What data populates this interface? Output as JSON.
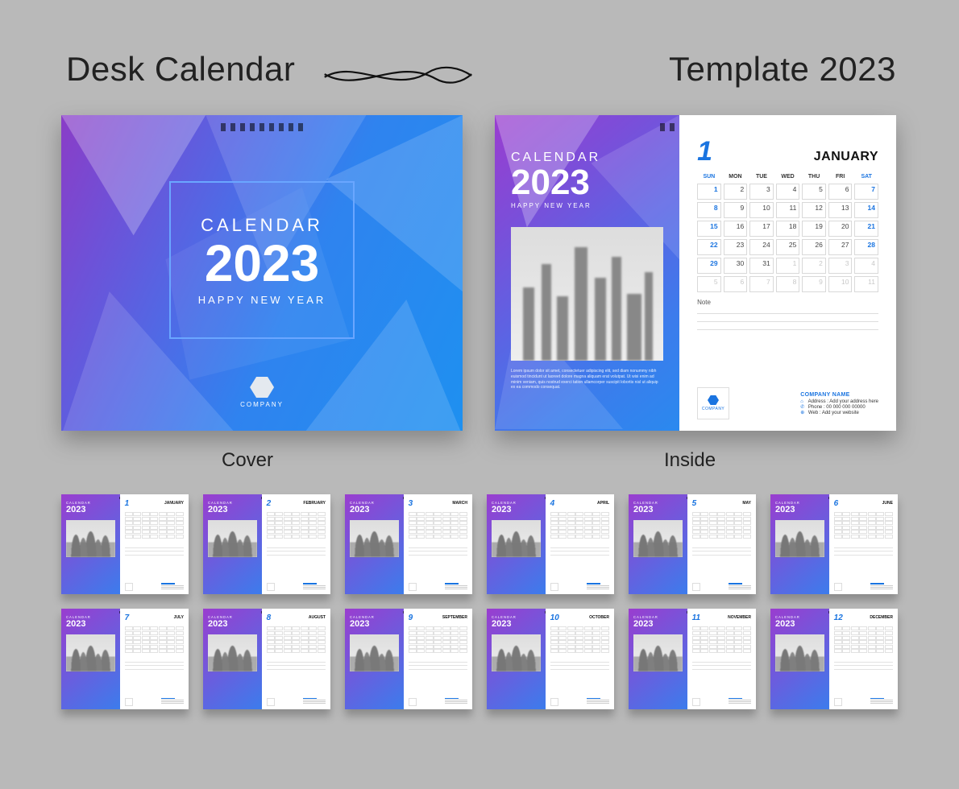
{
  "header": {
    "left": "Desk Calendar",
    "right": "Template 2023"
  },
  "labels": {
    "cover": "Cover",
    "inside": "Inside"
  },
  "cover": {
    "word": "CALENDAR",
    "year": "2023",
    "happy": "HAPPY NEW YEAR",
    "logo_text": "COMPANY"
  },
  "inside": {
    "left": {
      "word": "CALENDAR",
      "year": "2023",
      "happy": "HAPPY NEW YEAR",
      "lorem": "Lorem ipsum dolor sit amet, consectetuer adipiscing elit, sed diam nonummy nibh euismod tincidunt ut laoreet dolore magna aliquam erat volutpat. Ut wisi enim ad minim veniam, quis nostrud exerci tation ullamcorper suscipit lobortis nisl ut aliquip ex ea commodo consequat."
    },
    "right": {
      "month_number": "1",
      "month_name": "JANUARY",
      "days": [
        "SUN",
        "MON",
        "TUE",
        "WED",
        "THU",
        "FRI",
        "SAT"
      ],
      "grid": [
        [
          {
            "v": "1",
            "we": true
          },
          {
            "v": "2"
          },
          {
            "v": "3"
          },
          {
            "v": "4"
          },
          {
            "v": "5"
          },
          {
            "v": "6"
          },
          {
            "v": "7",
            "we": true
          }
        ],
        [
          {
            "v": "8",
            "we": true
          },
          {
            "v": "9"
          },
          {
            "v": "10"
          },
          {
            "v": "11"
          },
          {
            "v": "12"
          },
          {
            "v": "13"
          },
          {
            "v": "14",
            "we": true
          }
        ],
        [
          {
            "v": "15",
            "we": true
          },
          {
            "v": "16"
          },
          {
            "v": "17"
          },
          {
            "v": "18"
          },
          {
            "v": "19"
          },
          {
            "v": "20"
          },
          {
            "v": "21",
            "we": true
          }
        ],
        [
          {
            "v": "22",
            "we": true
          },
          {
            "v": "23"
          },
          {
            "v": "24"
          },
          {
            "v": "25"
          },
          {
            "v": "26"
          },
          {
            "v": "27"
          },
          {
            "v": "28",
            "we": true
          }
        ],
        [
          {
            "v": "29",
            "we": true
          },
          {
            "v": "30"
          },
          {
            "v": "31"
          },
          {
            "v": "1",
            "out": true
          },
          {
            "v": "2",
            "out": true
          },
          {
            "v": "3",
            "out": true
          },
          {
            "v": "4",
            "out": true
          }
        ],
        [
          {
            "v": "5",
            "out": true
          },
          {
            "v": "6",
            "out": true
          },
          {
            "v": "7",
            "out": true
          },
          {
            "v": "8",
            "out": true
          },
          {
            "v": "9",
            "out": true
          },
          {
            "v": "10",
            "out": true
          },
          {
            "v": "11",
            "out": true
          }
        ]
      ],
      "note_label": "Note",
      "company": {
        "name": "COMPANY NAME",
        "address_label": "Address :",
        "address_value": "Add your address here",
        "phone_label": "Phone :",
        "phone_value": "00 000 000 00000",
        "web_label": "Web :",
        "web_value": "Add your website",
        "logo_text": "COMPANY"
      }
    }
  },
  "thumbnails": [
    {
      "num": "1",
      "name": "JANUARY"
    },
    {
      "num": "2",
      "name": "FEBRUARY"
    },
    {
      "num": "3",
      "name": "MARCH"
    },
    {
      "num": "4",
      "name": "APRIL"
    },
    {
      "num": "5",
      "name": "MAY"
    },
    {
      "num": "6",
      "name": "JUNE"
    },
    {
      "num": "7",
      "name": "JULY"
    },
    {
      "num": "8",
      "name": "AUGUST"
    },
    {
      "num": "9",
      "name": "SEPTEMBER"
    },
    {
      "num": "10",
      "name": "OCTOBER"
    },
    {
      "num": "11",
      "name": "NOVEMBER"
    },
    {
      "num": "12",
      "name": "DECEMBER"
    }
  ],
  "thumb_left": {
    "word": "CALENDAR",
    "year": "2023"
  },
  "colors": {
    "accent": "#1a74e0",
    "gradient_from": "#9a3dcf",
    "gradient_to": "#2a89ef"
  }
}
